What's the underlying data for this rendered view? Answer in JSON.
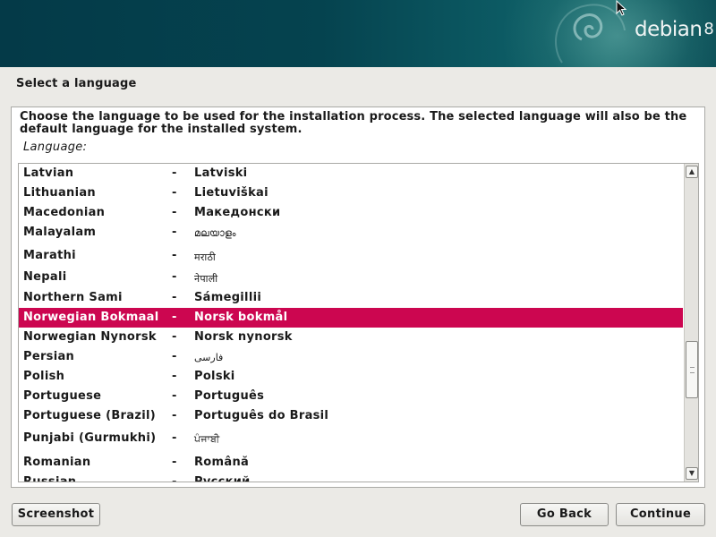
{
  "header": {
    "logo_text": "debian",
    "logo_version": "8"
  },
  "page": {
    "title": "Select a language",
    "instructions": "Choose the language to be used for the installation process. The selected language will also be the default language for the installed system.",
    "list_label": "Language:"
  },
  "languages": [
    {
      "name": "Latvian",
      "native": "Latviski"
    },
    {
      "name": "Lithuanian",
      "native": "Lietuviškai"
    },
    {
      "name": "Macedonian",
      "native": "Македонски"
    },
    {
      "name": "Malayalam",
      "native": "മലയാളം"
    },
    {
      "name": "Marathi",
      "native": "मराठी"
    },
    {
      "name": "Nepali",
      "native": "नेपाली"
    },
    {
      "name": "Northern Sami",
      "native": "Sámegillii"
    },
    {
      "name": "Norwegian Bokmaal",
      "native": "Norsk bokmål",
      "selected": true
    },
    {
      "name": "Norwegian Nynorsk",
      "native": "Norsk nynorsk"
    },
    {
      "name": "Persian",
      "native": "فارسی"
    },
    {
      "name": "Polish",
      "native": "Polski"
    },
    {
      "name": "Portuguese",
      "native": "Português"
    },
    {
      "name": "Portuguese (Brazil)",
      "native": "Português do Brasil"
    },
    {
      "name": "Punjabi (Gurmukhi)",
      "native": "ਪੰਜਾਬੀ"
    },
    {
      "name": "Romanian",
      "native": "Română"
    },
    {
      "name": "Russian",
      "native": "Русский"
    }
  ],
  "separator": "-",
  "buttons": {
    "screenshot": "Screenshot",
    "back": "Go Back",
    "continue": "Continue"
  },
  "colors": {
    "selection": "#cc0650",
    "banner": "#043a48",
    "background": "#ebeae6"
  }
}
